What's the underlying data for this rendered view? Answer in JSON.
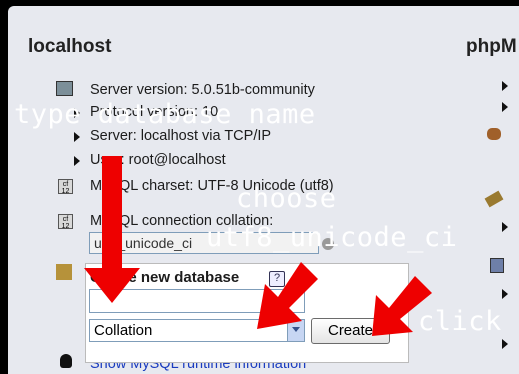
{
  "header": {
    "left_title": "localhost",
    "right_title": "phpM"
  },
  "server_info": {
    "version": "Server version: 5.0.51b-community",
    "protocol": "Protocol version: 10",
    "server": "Server: localhost via TCP/IP",
    "user": "User: root@localhost",
    "charset": "MySQL charset: UTF-8 Unicode (utf8)",
    "connection_collation_label": "MySQL connection collation:",
    "connection_collation_value": "utf8_unicode_ci"
  },
  "create_db": {
    "label": "Create new database",
    "help_icon": "?",
    "name_value": "",
    "collation_selected": "Collation",
    "create_label": "Create"
  },
  "footer": {
    "runtime_link": "Show MySQL runtime information"
  },
  "overlays": {
    "type_name": "type database name",
    "choose": "choose",
    "collation": "utf8_unicode_ci",
    "click": "click"
  },
  "icons": {
    "grid_glyph": "cf\n12"
  },
  "colors": {
    "arrow": "#ee0000",
    "link": "#1a3cbf",
    "panel": "#e7e9ef"
  }
}
